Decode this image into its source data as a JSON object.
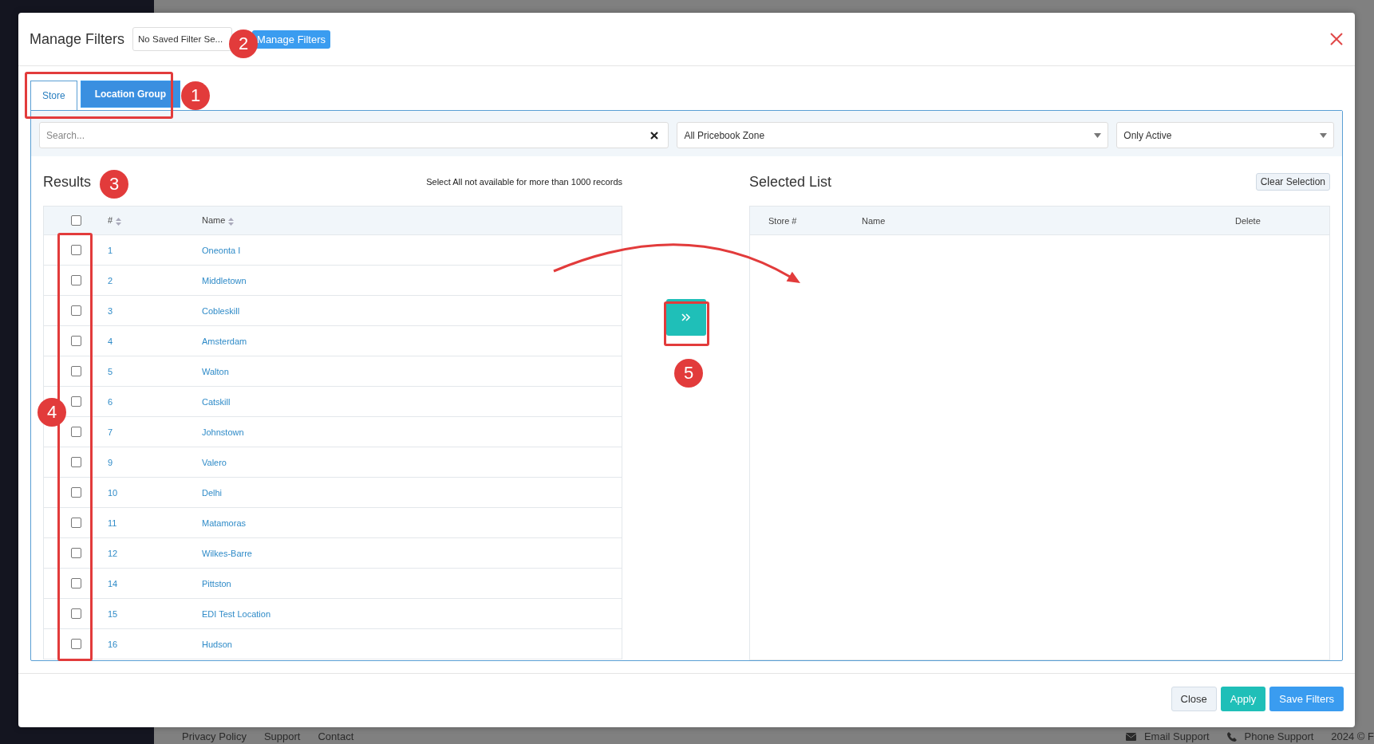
{
  "modal": {
    "title": "Manage Filters",
    "saved_filter": {
      "value": "No Saved Filter Se..."
    },
    "manage_button": "Manage Filters"
  },
  "tabs": [
    {
      "label": "Store",
      "selected": true
    },
    {
      "label": "Location Group",
      "selected": false
    }
  ],
  "search": {
    "placeholder": "Search..."
  },
  "dropdowns": [
    {
      "value": "All Pricebook Zone"
    },
    {
      "value": "Only Active"
    }
  ],
  "results": {
    "title": "Results",
    "note": "Select All not available for more than 1000 records",
    "select_all": {
      "checked": false
    },
    "columns": [
      "#",
      "Name"
    ],
    "rows": [
      {
        "number": "1",
        "name": "Oneonta I",
        "checked": false
      },
      {
        "number": "2",
        "name": "Middletown",
        "checked": false
      },
      {
        "number": "3",
        "name": "Cobleskill",
        "checked": false
      },
      {
        "number": "4",
        "name": "Amsterdam",
        "checked": false
      },
      {
        "number": "5",
        "name": "Walton",
        "checked": false
      },
      {
        "number": "6",
        "name": "Catskill",
        "checked": false
      },
      {
        "number": "7",
        "name": "Johnstown",
        "checked": false
      },
      {
        "number": "9",
        "name": "Valero",
        "checked": false
      },
      {
        "number": "10",
        "name": "Delhi",
        "checked": false
      },
      {
        "number": "11",
        "name": "Matamoras",
        "checked": false
      },
      {
        "number": "12",
        "name": "Wilkes-Barre",
        "checked": false
      },
      {
        "number": "14",
        "name": "Pittston",
        "checked": false
      },
      {
        "number": "15",
        "name": "EDI Test Location",
        "checked": false
      },
      {
        "number": "16",
        "name": "Hudson",
        "checked": false
      }
    ]
  },
  "selected_list": {
    "title": "Selected List",
    "clear_button": "Clear Selection",
    "columns": [
      "Store #",
      "Name",
      "Delete"
    ]
  },
  "footer_buttons": [
    {
      "label": "Close",
      "kind": "default"
    },
    {
      "label": "Apply",
      "kind": "success"
    },
    {
      "label": "Save Filters",
      "kind": "primary"
    }
  ],
  "annotations": [
    {
      "label": "1"
    },
    {
      "label": "2"
    },
    {
      "label": "3"
    },
    {
      "label": "4"
    },
    {
      "label": "5"
    }
  ],
  "page_footer": {
    "links": [
      "Privacy Policy",
      "Support",
      "Contact"
    ],
    "contacts": [
      {
        "label": "Email Support",
        "kind": "email"
      },
      {
        "label": "Phone Support",
        "kind": "phone"
      }
    ],
    "copyright": "2024 © F"
  }
}
